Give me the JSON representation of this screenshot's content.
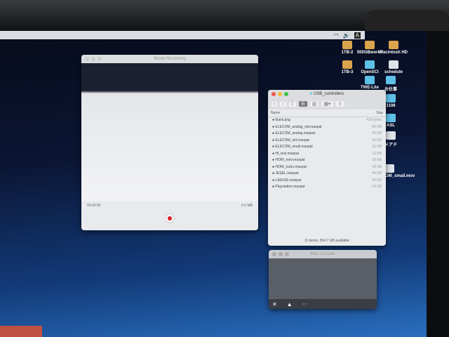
{
  "menubar": {
    "items": [
      "wifi-icon",
      "volume-icon",
      "A"
    ]
  },
  "desktop_icons": [
    {
      "label": "1TB-2",
      "icon": "drive-icon"
    },
    {
      "label": "500GBwork7",
      "icon": "drive-icon"
    },
    {
      "label": "Macintosh HD",
      "icon": "drive-icon"
    },
    {
      "label": "1TB-3",
      "icon": "drive-icon"
    },
    {
      "label": "OpenSCI",
      "icon": "folder-icon"
    },
    {
      "label": "schedule",
      "icon": "document-icon"
    },
    {
      "label": "TWE-Lite",
      "icon": "folder-icon"
    },
    {
      "label": "お仕事",
      "icon": "folder-icon"
    },
    {
      "label": "1106",
      "icon": "folder-icon"
    },
    {
      "label": "ASL",
      "icon": "folder-icon"
    },
    {
      "label": "メアド",
      "icon": "document-icon"
    },
    {
      "label": "ELECOM_small.mov",
      "icon": "movie-icon"
    }
  ],
  "movie": {
    "title": "Movie Recording",
    "time": "00:00:00",
    "size": "0.0 MB"
  },
  "finder": {
    "title": "USB_controllers",
    "columns": {
      "name": "Name",
      "size": "Size"
    },
    "files": [
      {
        "name": "black.png",
        "size": "426 bytes"
      },
      {
        "name": "ELECOM_analog_old.maxpat",
        "size": "95 KB"
      },
      {
        "name": "ELECOM_analog.maxpat",
        "size": "95 KB"
      },
      {
        "name": "ELECOM_old.maxpat",
        "size": "15 KB"
      },
      {
        "name": "ELECOM_small.maxpat",
        "size": "15 KB"
      },
      {
        "name": "HI_test.maxpat",
        "size": "12 KB"
      },
      {
        "name": "HORI_mini.maxpat",
        "size": "18 KB"
      },
      {
        "name": "HORI_turbo.maxpat",
        "size": "18 KB"
      },
      {
        "name": "JESEL.maxpat",
        "size": "94 KB"
      },
      {
        "name": "LANJUE.maxpat",
        "size": "94 KB"
      },
      {
        "name": "Playstation.maxpat",
        "size": "14 KB"
      }
    ],
    "status": "11 items, 354.7 GB available"
  },
  "max_console": {
    "title": "Max Console"
  }
}
